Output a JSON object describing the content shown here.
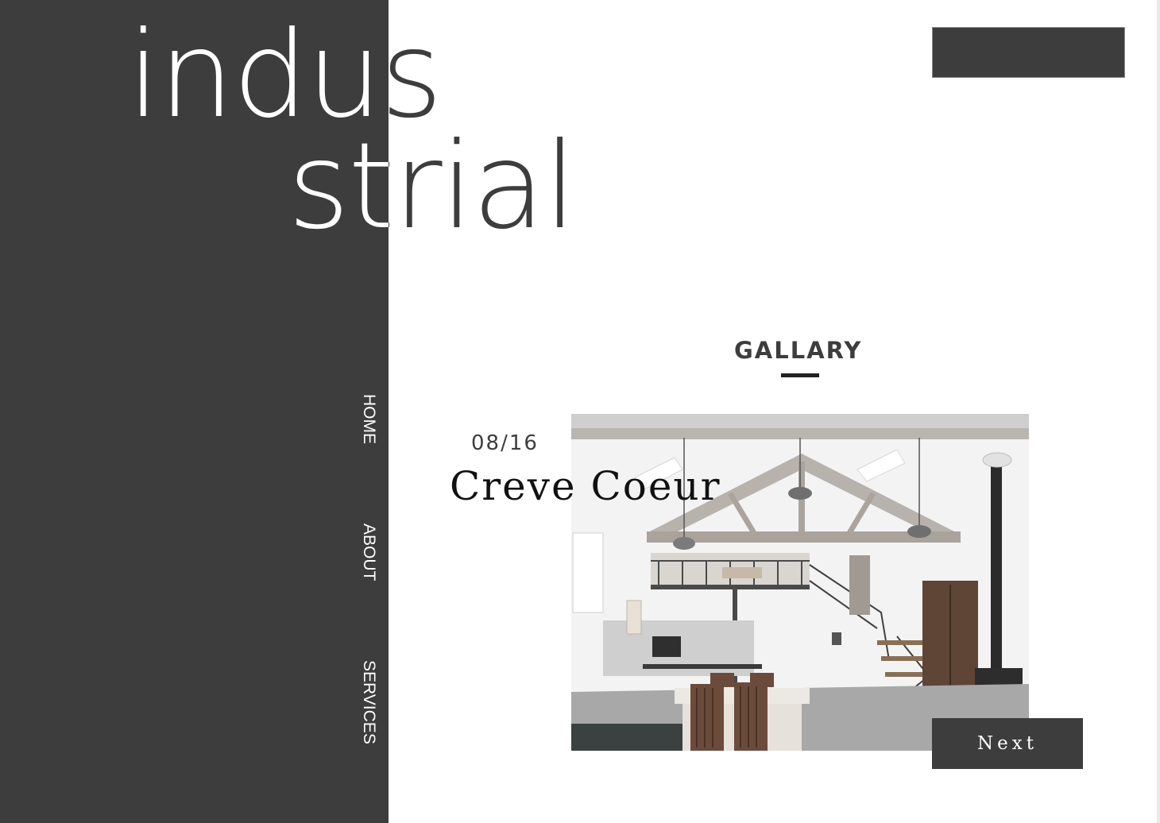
{
  "hero": {
    "word_line1": "indus",
    "word_line2": "strial"
  },
  "nav": {
    "items": [
      {
        "label": "HOME"
      },
      {
        "label": "ABOUT"
      },
      {
        "label": "SERVICES"
      }
    ]
  },
  "gallery": {
    "title": "GALLARY",
    "counter": "08/16",
    "caption": "Creve Coeur",
    "photo_alt": "Industrial loft interior with wooden trusses, mezzanine and stairs",
    "next_label": "Next"
  },
  "colors": {
    "dark_panel": "#3d3d3d",
    "background": "#ffffff",
    "text_dark": "#3d3d3d"
  }
}
